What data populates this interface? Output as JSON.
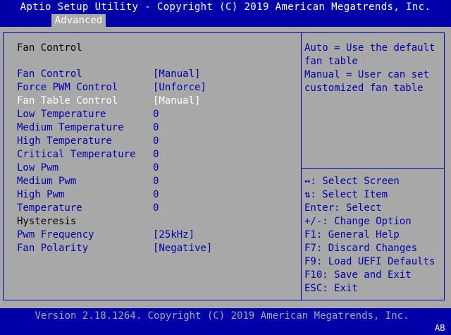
{
  "header": {
    "title": "Aptio Setup Utility - Copyright (C) 2019 American Megatrends, Inc.",
    "tab": "Advanced"
  },
  "section_title": "Fan Control",
  "settings": [
    {
      "label": "Fan Control",
      "value": "[Manual]"
    },
    {
      "label": "Force PWM Control",
      "value": "[Unforce]"
    },
    {
      "label": "Fan Table Control",
      "value": "[Manual]"
    },
    {
      "label": "Low Temperature",
      "value": "0"
    },
    {
      "label": "Medium Temperature",
      "value": "0"
    },
    {
      "label": "High Temperature",
      "value": "0"
    },
    {
      "label": "Critical Temperature",
      "value": "0"
    },
    {
      "label": "Low Pwm",
      "value": "0"
    },
    {
      "label": "Medium Pwm",
      "value": "0"
    },
    {
      "label": "High Pwm",
      "value": "0"
    },
    {
      "label": "Temperature",
      "value": "0"
    },
    {
      "label": "Hysteresis",
      "value": ""
    },
    {
      "label": "Pwm Frequency",
      "value": "[25kHz]"
    },
    {
      "label": "Fan Polarity",
      "value": "[Negative]"
    }
  ],
  "help": [
    "Auto = Use the default",
    "fan table",
    "Manual = User can set",
    "customized fan table"
  ],
  "keys": [
    "↔: Select Screen",
    "⇅: Select Item",
    "Enter: Select",
    "+/-: Change Option",
    "F1: General Help",
    "F7: Discard Changes",
    "F9: Load UEFI Defaults",
    "F10: Save and Exit",
    "ESC: Exit"
  ],
  "footer": {
    "version": "Version 2.18.1264. Copyright (C) 2019 American Megatrends, Inc.",
    "badge": "AB"
  }
}
